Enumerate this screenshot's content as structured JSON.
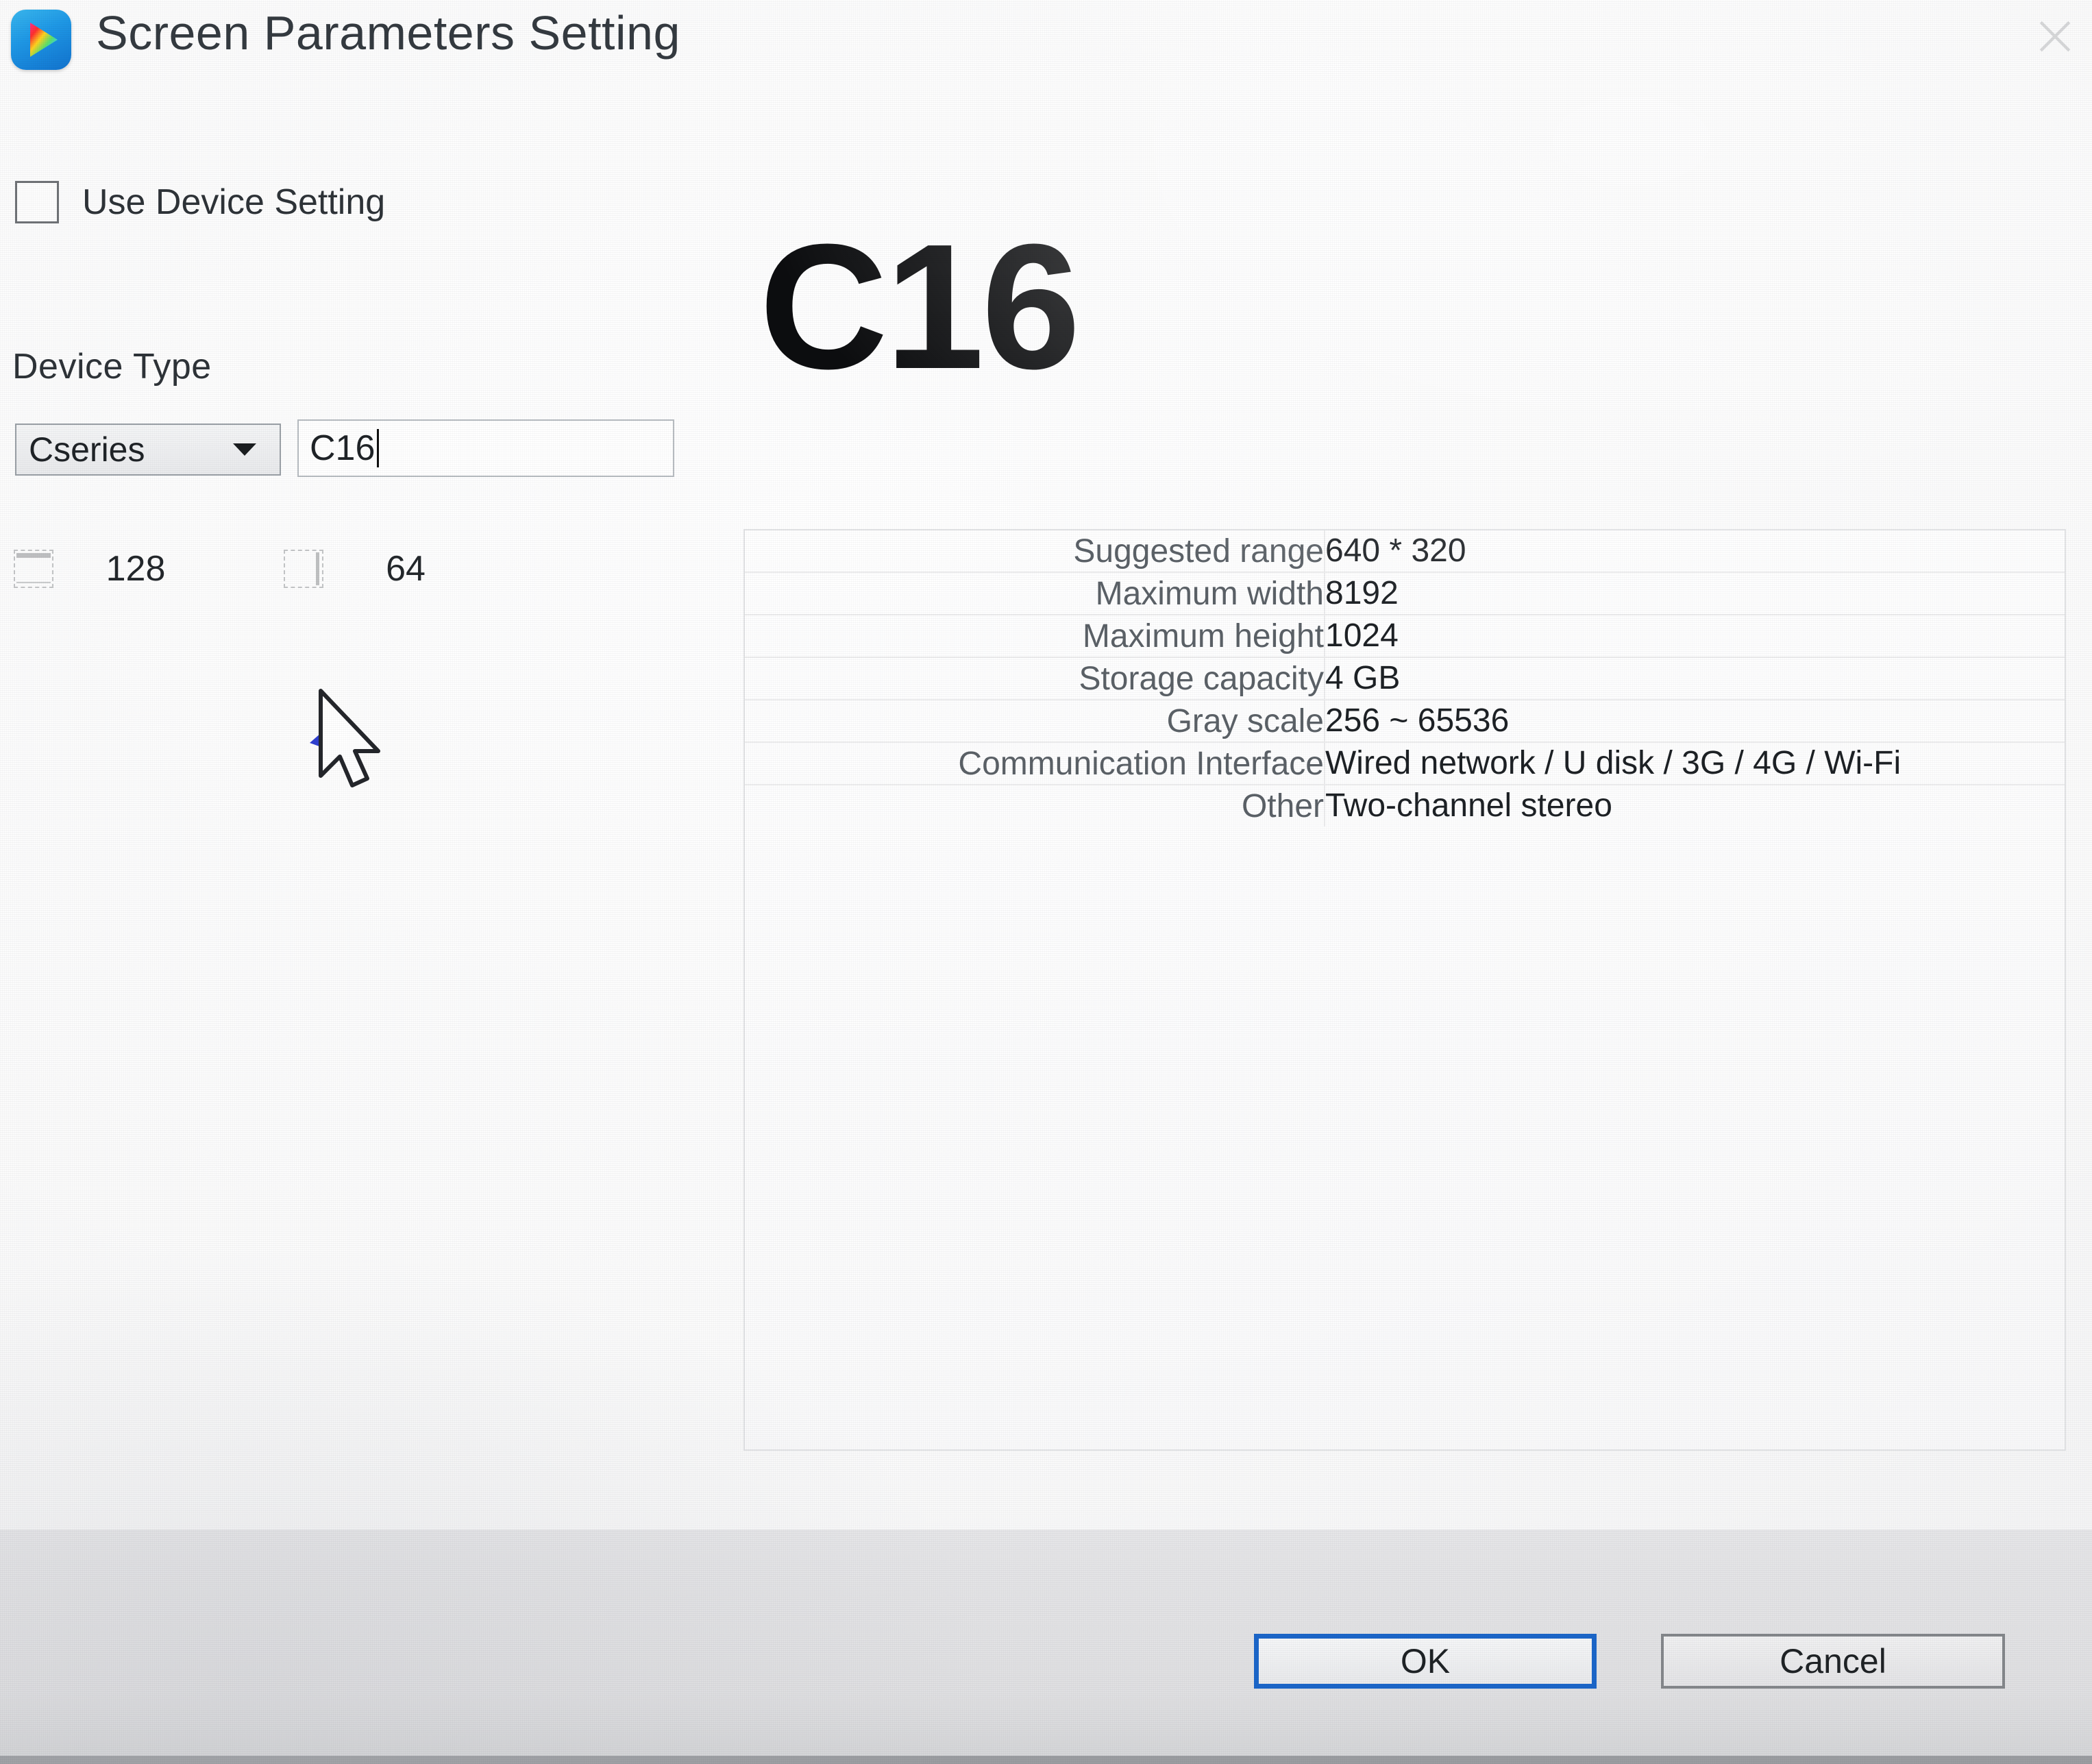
{
  "window": {
    "title": "Screen Parameters Setting",
    "app_icon": "media-play-icon",
    "close_icon": "×"
  },
  "form": {
    "use_device_setting": {
      "label": "Use Device Setting",
      "checked": false
    },
    "device_type": {
      "label": "Device Type",
      "selected": "Cseries",
      "caret_icon": "chevron-down-icon"
    },
    "device_name": {
      "value": "C16"
    },
    "size": {
      "width_icon": "screen-width-icon",
      "width": "128",
      "height_icon": "screen-height-icon",
      "height": "64"
    }
  },
  "banner": {
    "model": "C16"
  },
  "spec_table": {
    "rows": [
      {
        "label": "Suggested range",
        "value": "640 * 320"
      },
      {
        "label": "Maximum width",
        "value": "8192"
      },
      {
        "label": "Maximum height",
        "value": "1024"
      },
      {
        "label": "Storage capacity",
        "value": "4 GB"
      },
      {
        "label": "Gray scale",
        "value": "256 ~ 65536"
      },
      {
        "label": "Communication Interface",
        "value": "Wired network / U disk / 3G / 4G / Wi-Fi"
      },
      {
        "label": "Other",
        "value": "Two-channel stereo"
      }
    ]
  },
  "footer": {
    "ok_label": "OK",
    "cancel_label": "Cancel"
  },
  "colors": {
    "accent": "#1b66c9",
    "dialog_background": "#fbfbfb",
    "footer_background": "#e0e0e2",
    "label_text": "#5b6167",
    "value_text": "#1d2125"
  }
}
